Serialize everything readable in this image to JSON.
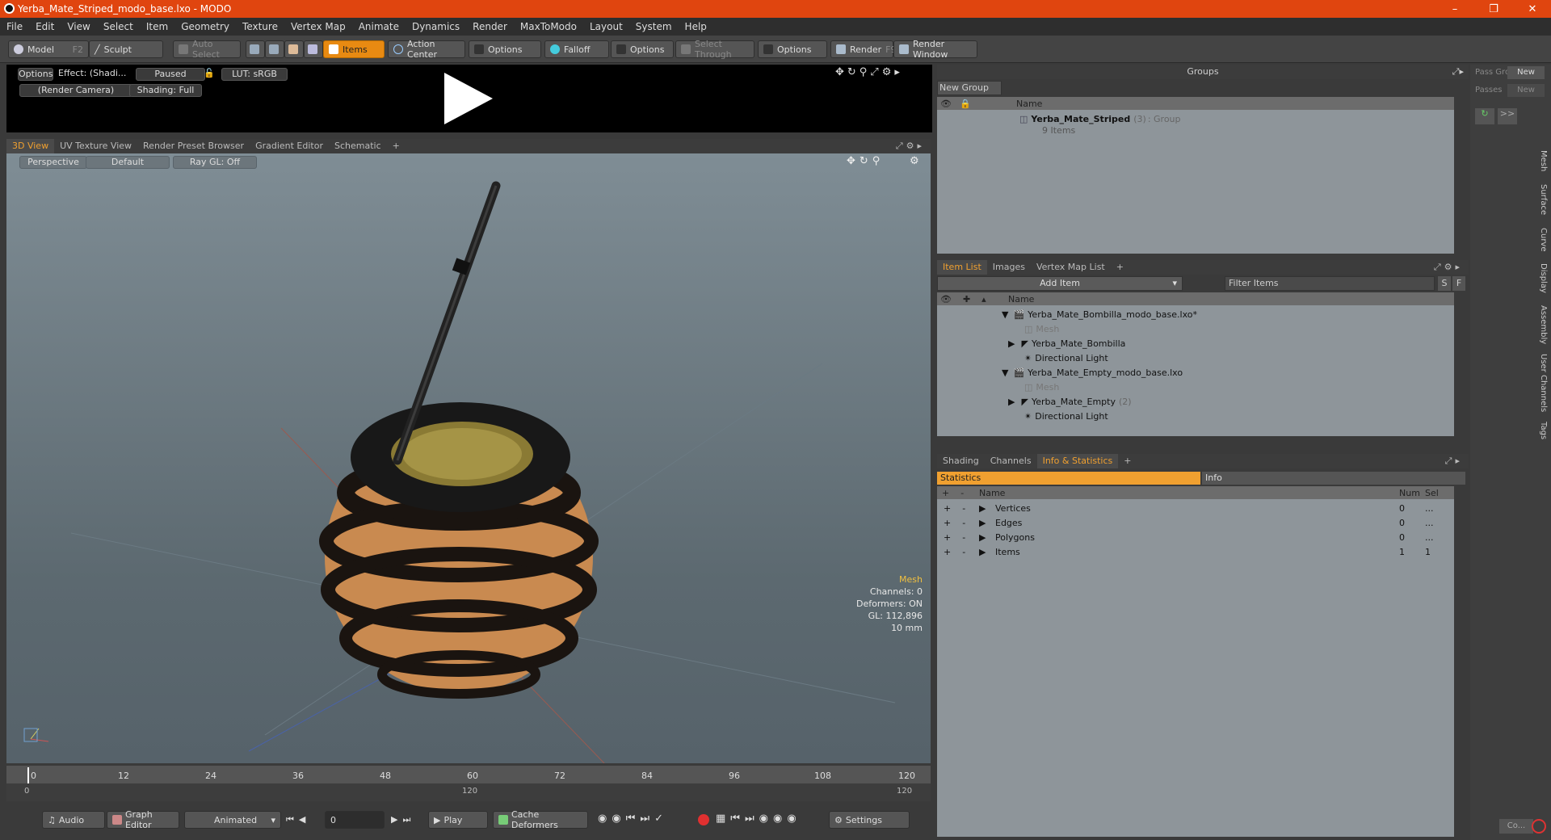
{
  "app": {
    "title": "Yerba_Mate_Striped_modo_base.lxo - MODO"
  },
  "menu": [
    "File",
    "Edit",
    "View",
    "Select",
    "Item",
    "Geometry",
    "Texture",
    "Vertex Map",
    "Animate",
    "Dynamics",
    "Render",
    "MaxToModo",
    "Layout",
    "System",
    "Help"
  ],
  "toolbar": {
    "model": "Model",
    "model_key": "F2",
    "sculpt": "Sculpt",
    "auto_select": "Auto Select",
    "items": "Items",
    "action_center": "Action Center",
    "options1": "Options",
    "falloff": "Falloff",
    "options2": "Options",
    "select_through": "Select Through",
    "options3": "Options",
    "render": "Render",
    "render_key": "F9",
    "render_window": "Render Window"
  },
  "preview": {
    "options": "Options",
    "effect": "Effect: (Shadi...",
    "paused": "Paused",
    "lut": "LUT: sRGB",
    "camera": "(Render Camera)",
    "shading": "Shading: Full"
  },
  "view_tabs": [
    "3D View",
    "UV Texture View",
    "Render Preset Browser",
    "Gradient Editor",
    "Schematic",
    "+"
  ],
  "viewport": {
    "perspective": "Perspective",
    "default": "Default",
    "raygl": "Ray GL: Off",
    "info_mesh": "Mesh",
    "info_channels": "Channels: 0",
    "info_deformers": "Deformers: ON",
    "info_gl": "GL: 112,896",
    "info_scale": "10 mm"
  },
  "timeline": {
    "ticks": [
      "0",
      "12",
      "24",
      "36",
      "48",
      "60",
      "72",
      "84",
      "96",
      "108",
      "120"
    ],
    "range_start": "0",
    "range_mid": "120",
    "range_end": "120"
  },
  "bottom": {
    "audio": "Audio",
    "graph_editor": "Graph Editor",
    "animated": "Animated",
    "frame": "0",
    "play": "Play",
    "cache": "Cache Deformers",
    "settings": "Settings"
  },
  "groups": {
    "title": "Groups",
    "new_group": "New Group",
    "col_name": "Name",
    "group_name": "Yerba_Mate_Striped",
    "group_count": "(3)",
    "group_type": ": Group",
    "group_items": "9 Items"
  },
  "right_strip": {
    "pass_gro": "Pass Gro",
    "passes": "Passes",
    "new1": "New",
    "new2": "New",
    "co": "Co...",
    "tabs": [
      "Mesh",
      "Surface",
      "Curve",
      "Display",
      "Assembly",
      "User Channels",
      "Tags"
    ]
  },
  "itemlist": {
    "tabs": [
      "Item List",
      "Images",
      "Vertex Map List",
      "+"
    ],
    "add_item": "Add Item",
    "filter": "Filter Items",
    "s": "S",
    "f": "F",
    "col_name": "Name",
    "rows": [
      {
        "label": "Yerba_Mate_Bombilla_modo_base.lxo*",
        "suffix": ""
      },
      {
        "label": "Mesh",
        "suffix": ""
      },
      {
        "label": "Yerba_Mate_Bombilla",
        "suffix": ""
      },
      {
        "label": "Directional Light",
        "suffix": ""
      },
      {
        "label": "Yerba_Mate_Empty_modo_base.lxo",
        "suffix": ""
      },
      {
        "label": "Mesh",
        "suffix": ""
      },
      {
        "label": "Yerba_Mate_Empty",
        "suffix": "(2)"
      },
      {
        "label": "Directional Light",
        "suffix": ""
      }
    ]
  },
  "stats": {
    "tabs": [
      "Shading",
      "Channels",
      "Info & Statistics",
      "+"
    ],
    "statistics": "Statistics",
    "info": "Info",
    "col_name": "Name",
    "col_num": "Num",
    "col_sel": "Sel",
    "rows": [
      {
        "name": "Vertices",
        "num": "0",
        "sel": "..."
      },
      {
        "name": "Edges",
        "num": "0",
        "sel": "..."
      },
      {
        "name": "Polygons",
        "num": "0",
        "sel": "..."
      },
      {
        "name": "Items",
        "num": "1",
        "sel": "1"
      }
    ]
  }
}
